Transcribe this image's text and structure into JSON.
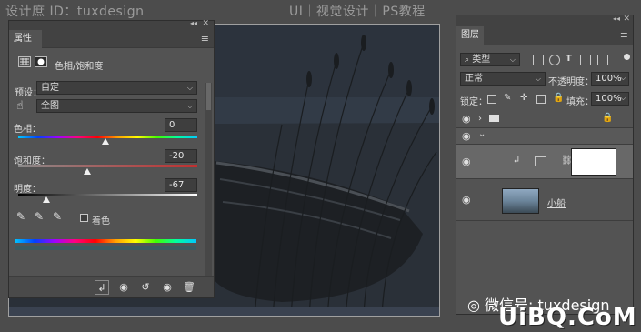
{
  "watermark": {
    "top_left": "设计庶 ID：tuxdesign",
    "bottom": "微信号: tuxdesign",
    "logo": "UiBQ.CoM"
  },
  "site_title": "UI｜视觉设计｜PS教程",
  "properties": {
    "tab": "属性",
    "adjustment_name": "色相/饱和度",
    "preset_label": "预设：",
    "preset_value": "自定",
    "channel_value": "全图",
    "hue": {
      "label": "色相：",
      "value": "0"
    },
    "saturation": {
      "label": "饱和度：",
      "value": "-20"
    },
    "lightness": {
      "label": "明度：",
      "value": "-67"
    },
    "colorize_label": "着色"
  },
  "layers": {
    "tab": "图层",
    "filter_kind": "类型",
    "blend_mode": "正常",
    "opacity_label": "不透明度：",
    "opacity_value": "100%",
    "lock_label": "锁定：",
    "fill_label": "填充：",
    "fill_value": "100%",
    "items": [
      {
        "type": "group",
        "name": ""
      },
      {
        "type": "group-open",
        "name": ""
      },
      {
        "type": "adjustment",
        "name": ""
      },
      {
        "type": "image",
        "name": "小船"
      }
    ]
  },
  "colors": {
    "panel_bg": "#535353",
    "dark_bg": "#424242",
    "accent_white": "#ffffff"
  }
}
